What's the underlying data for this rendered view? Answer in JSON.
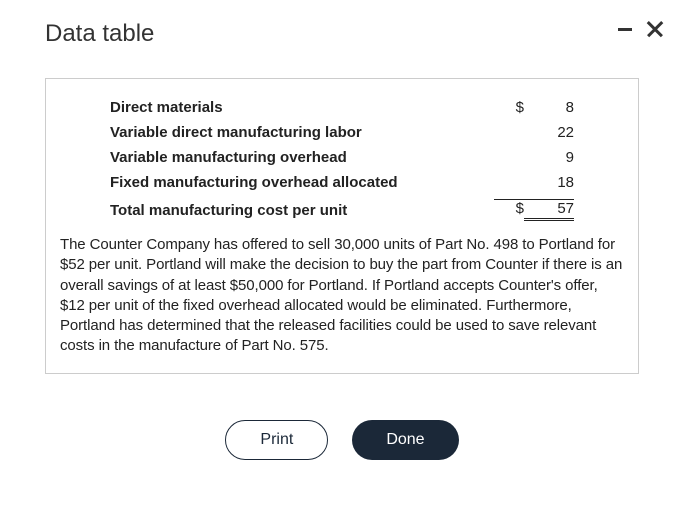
{
  "header": {
    "title": "Data table"
  },
  "table": {
    "rows": [
      {
        "label": "Direct materials",
        "currency": "$",
        "value": "8"
      },
      {
        "label": "Variable direct manufacturing labor",
        "currency": "",
        "value": "22"
      },
      {
        "label": "Variable manufacturing overhead",
        "currency": "",
        "value": "9"
      },
      {
        "label": "Fixed manufacturing overhead allocated",
        "currency": "",
        "value": "18"
      }
    ],
    "total": {
      "label": "Total manufacturing cost per unit",
      "currency": "$",
      "value": "57"
    }
  },
  "description": "The Counter Company has offered to sell 30,000 units of Part No. 498 to Portland for $52 per unit. Portland will make the decision to buy the part from Counter if there is an overall savings of at least $50,000 for Portland. If Portland accepts Counter's offer, $12 per unit of the fixed overhead allocated would be eliminated. Furthermore, Portland has determined that the released facilities could be used to save relevant costs in the manufacture of Part No. 575.",
  "buttons": {
    "print": "Print",
    "done": "Done"
  }
}
